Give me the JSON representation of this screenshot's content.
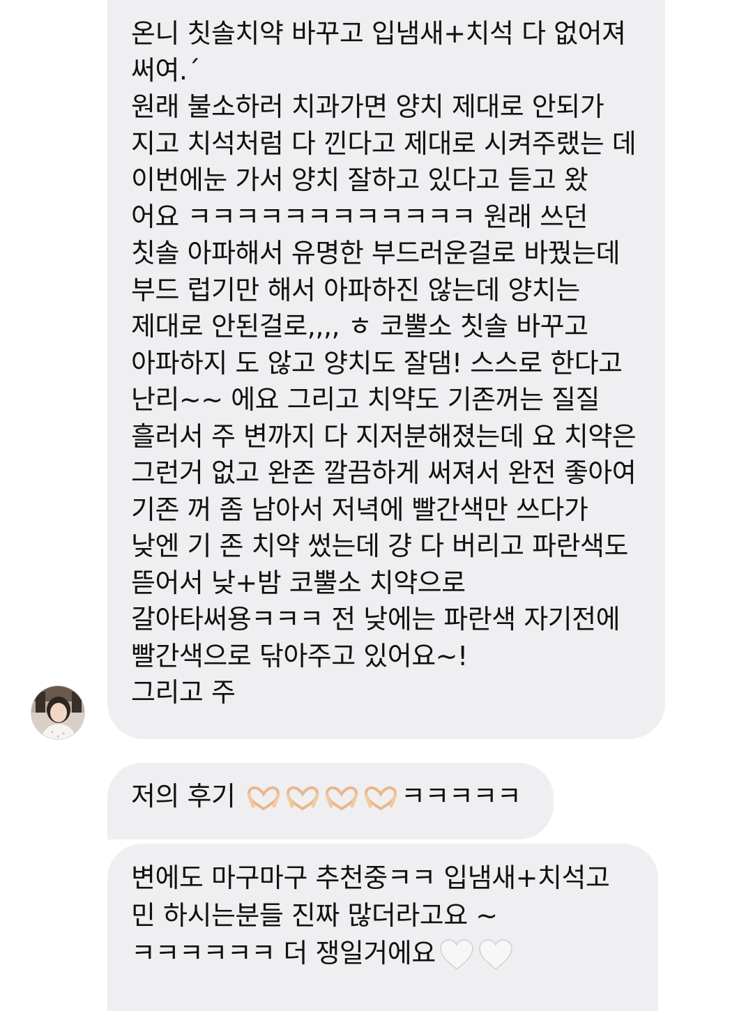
{
  "chat": {
    "message_1": {
      "text": "온니 칫솔치약 바꾸고 입냄새+치석 다 없어져 써여.ˊ\n원래 불소하러 치과가면 양치 제대로 안되가 지고 치석처럼 다 낀다고 제대로 시켜주랬는 데 이번에눈 가서 양치 잘하고 있다고 듣고 왔 어요 ㅋㅋㅋㅋㅋㅋㅋㅋㅋㅋㅋㅋ 원래 쓰던 칫솔 아파해서 유명한 부드러운걸로 바꿨는데 부드 럽기만 해서 아파하진 않는데 양치는 제대로 안된걸로,,,, ㅎ 코뿔소 칫솔 바꾸고 아파하지 도 않고 양치도 잘댐! 스스로 한다고 난리~~ 에요 그리고 치약도 기존꺼는 질질 흘러서 주 변까지 다 지저분해졌는데 요 치약은 그런거 없고 완존 깔끔하게 써져서 완전 좋아여 기존 꺼 좀 남아서 저녁에 빨간색만 쓰다가 낮엔 기 존 치약 썼는데 걍 다 버리고 파란색도 뜯어서 낮+밤 코뿔소 치약으로 갈아타써용ㅋㅋㅋ 전 낮에는 파란색 자기전에 빨간색으로 닦아주고 있어요~!\n그리고 주"
    },
    "message_2": {
      "text_before": "저의 후기",
      "emojis": [
        "heart-hands-emoji",
        "heart-hands-emoji",
        "heart-hands-emoji",
        "heart-hands-emoji"
      ],
      "text_after": "ㅋㅋㅋㅋㅋ"
    },
    "message_3": {
      "text": "변에도 마구마구 추천중ㅋㅋ 입냄새+치석고 민 하시는분들 진짜 많더라고요 ~ㅋㅋㅋㅋㅋㅋ 더 쟁일거에요",
      "emojis": [
        "white-heart-emoji",
        "white-heart-emoji"
      ]
    },
    "avatar": {
      "icon": "profile-avatar"
    }
  },
  "colors": {
    "bubble": "#efeff2",
    "text": "#111111",
    "background": "#ffffff"
  }
}
